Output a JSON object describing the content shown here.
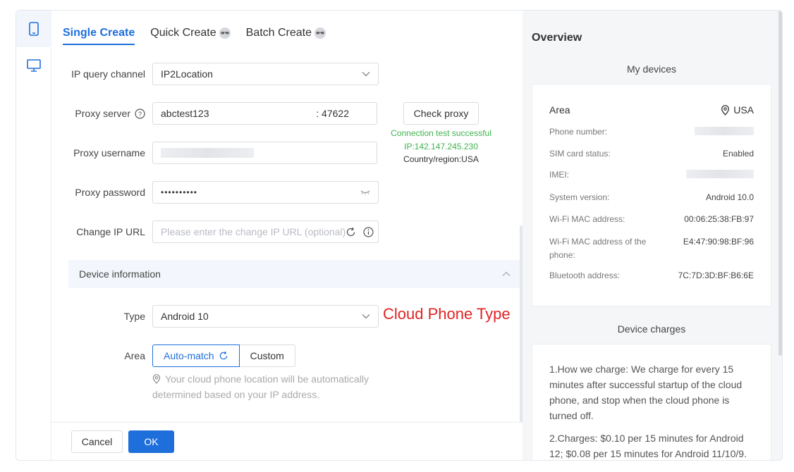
{
  "tabs": [
    {
      "label": "Single Create"
    },
    {
      "label": "Quick Create"
    },
    {
      "label": "Batch Create"
    }
  ],
  "form": {
    "ip_channel": {
      "label": "IP query channel",
      "value": "IP2Location"
    },
    "proxy_server": {
      "label": "Proxy server",
      "host": "abctest123",
      "port": ": 47622"
    },
    "proxy_username": {
      "label": "Proxy username"
    },
    "proxy_password": {
      "label": "Proxy password",
      "value": "••••••••••"
    },
    "change_ip": {
      "label": "Change IP URL",
      "placeholder": "Please enter the change IP URL (optional)"
    },
    "check_proxy": {
      "label": "Check proxy"
    },
    "check_result": {
      "status": "Connection test successful",
      "ip": "IP:142.147.245.230",
      "country": "Country/region:USA"
    }
  },
  "device_section": {
    "title": "Device information"
  },
  "device": {
    "type": {
      "label": "Type",
      "value": "Android 10"
    },
    "area": {
      "label": "Area",
      "auto_label": "Auto-match",
      "custom_label": "Custom"
    },
    "hint": "Your cloud phone location will be automatically determined based on your IP address."
  },
  "annotation": "Cloud Phone Type",
  "footer": {
    "cancel": "Cancel",
    "ok": "OK"
  },
  "overview": {
    "title": "Overview",
    "my_devices": "My devices",
    "area": {
      "label": "Area",
      "value": "USA"
    },
    "rows": [
      {
        "label": "Phone number:",
        "value": ""
      },
      {
        "label": "SIM card status:",
        "value": "Enabled"
      },
      {
        "label": "IMEI:",
        "value": ""
      },
      {
        "label": "System version:",
        "value": "Android 10.0"
      },
      {
        "label": "Wi-Fi MAC address:",
        "value": "00:06:25:38:FB:97"
      },
      {
        "label": "Wi-Fi MAC address of the phone:",
        "value": "E4:47:90:98:BF:96"
      },
      {
        "label": "Bluetooth address:",
        "value": "7C:7D:3D:BF:B6:6E"
      }
    ],
    "device_charges": "Device charges",
    "charges": [
      "1.How we charge: We charge for every 15 minutes after successful startup of the cloud phone, and stop when the cloud phone is turned off.",
      "2.Charges: $0.10 per 15 minutes for Android 12; $0.08 per 15 minutes for Android 11/10/9."
    ]
  },
  "colors": {
    "accent": "#1e6fdc",
    "success": "#3fb34f",
    "annotation": "#e02424"
  }
}
